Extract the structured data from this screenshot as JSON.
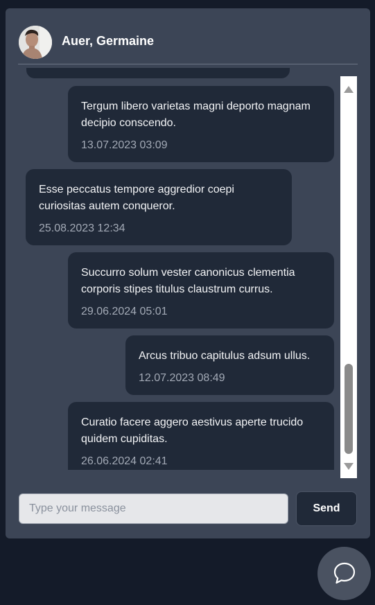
{
  "header": {
    "contact_name": "Auer, Germaine",
    "avatar_icon": "person-avatar"
  },
  "messages": [
    {
      "direction": "outgoing",
      "text": "Tergum libero varietas magni deporto magnam decipio conscendo.",
      "timestamp": "13.07.2023 03:09"
    },
    {
      "direction": "incoming",
      "text": "Esse peccatus tempore aggredior coepi curiositas autem conqueror.",
      "timestamp": "25.08.2023 12:34"
    },
    {
      "direction": "outgoing",
      "text": "Succurro solum vester canonicus clementia corporis stipes titulus claustrum currus.",
      "timestamp": "29.06.2024 05:01"
    },
    {
      "direction": "outgoing",
      "text": "Arcus tribuo capitulus adsum ullus.",
      "timestamp": "12.07.2023 08:49"
    },
    {
      "direction": "outgoing",
      "text": "Curatio facere aggero aestivus aperte trucido quidem cupiditas.",
      "timestamp": "26.06.2024 02:41"
    }
  ],
  "composer": {
    "placeholder": "Type your message",
    "value": "",
    "send_label": "Send"
  },
  "launcher": {
    "icon": "chat-bubble-icon"
  },
  "colors": {
    "page_background": "#141b29",
    "window_background": "#3c4556",
    "bubble_background": "#202938",
    "timestamp_text": "#a3aab6"
  }
}
